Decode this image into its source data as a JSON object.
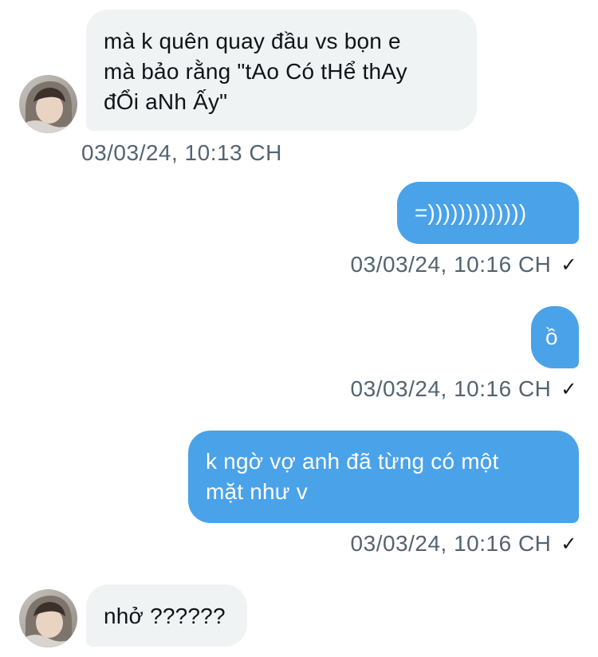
{
  "messages": [
    {
      "direction": "incoming",
      "text": "mà k quên quay đầu vs bọn e\nmà bảo rằng \"tAo Có tHể thAy\nđỔi aNh Ấy\"",
      "timestamp": "03/03/24, 10:13 CH"
    },
    {
      "direction": "outgoing",
      "text": "=)))))))))))))",
      "timestamp": "03/03/24, 10:16 CH",
      "status_icon": "✓"
    },
    {
      "direction": "outgoing",
      "text": "ồ",
      "timestamp": "03/03/24, 10:16 CH",
      "status_icon": "✓"
    },
    {
      "direction": "outgoing",
      "text": "k ngờ vợ anh đã từng có một\nmặt như v",
      "timestamp": "03/03/24, 10:16 CH",
      "status_icon": "✓"
    },
    {
      "direction": "incoming",
      "text": "nhở ??????"
    }
  ],
  "colors": {
    "incoming_bubble": "#eff3f4",
    "outgoing_bubble": "#4aa2e9",
    "timestamp_text": "#536471",
    "incoming_text": "#0f1419",
    "outgoing_text": "#ffffff"
  },
  "icons": {
    "read_receipt": "checkmark-icon",
    "sender_avatar": "avatar"
  }
}
